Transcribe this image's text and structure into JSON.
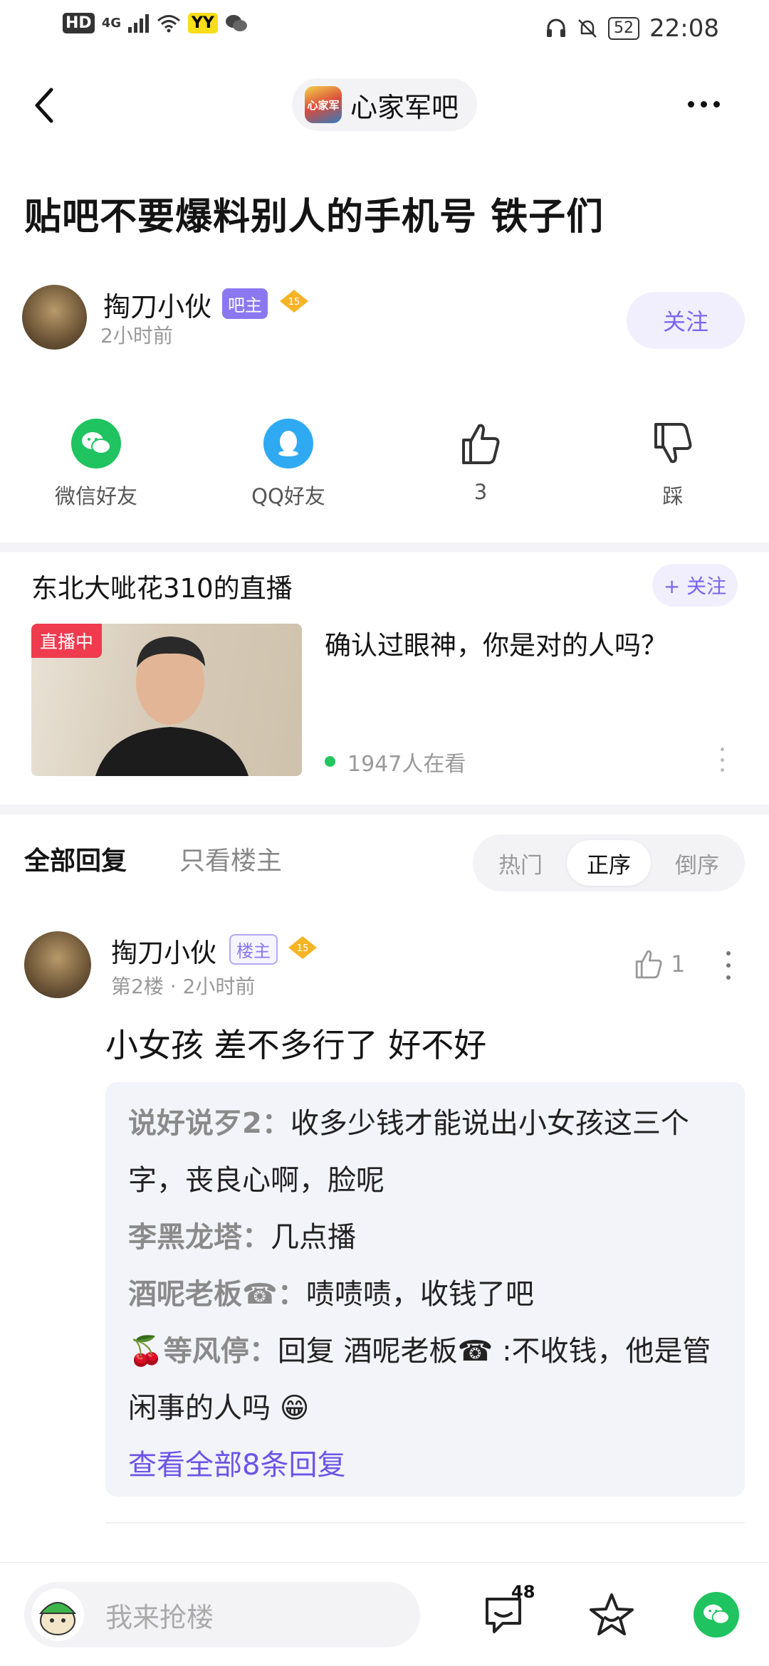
{
  "status_bar": {
    "hd": "HD",
    "network": "4G",
    "yy_badge": "YY",
    "battery": "52",
    "time": "22:08"
  },
  "header": {
    "forum_logo_text": "心家军",
    "forum_name": "心家军吧"
  },
  "post": {
    "title": "贴吧不要爆料别人的手机号 铁子们",
    "author": {
      "name": "掏刀小伙",
      "badge": "吧主",
      "level": "15",
      "time": "2小时前"
    },
    "follow_label": "关注"
  },
  "share": {
    "wechat": "微信好友",
    "qq": "QQ好友",
    "like_count": "3",
    "dislike": "踩"
  },
  "live": {
    "title": "东北大呲花310的直播",
    "follow_label": "+ 关注",
    "badge": "直播中",
    "description": "确认过眼神，你是对的人吗？",
    "viewers": "1947人在看"
  },
  "reply_tabs": {
    "all": "全部回复",
    "op_only": "只看楼主",
    "sort": [
      "热门",
      "正序",
      "倒序"
    ],
    "selected_sort": "正序"
  },
  "reply": {
    "name": "掏刀小伙",
    "badge": "楼主",
    "level": "15",
    "floor": "第2楼 · 2小时前",
    "like_count": "1",
    "content": "小女孩 差不多行了 好不好",
    "sub_replies": [
      {
        "author": "说好说歹2",
        "text": "收多少钱才能说出小女孩这三个字，丧良心啊，脸呢"
      },
      {
        "author": "李黑龙塔",
        "text": "几点播"
      },
      {
        "author": "酒呢老板☎",
        "text": "啧啧啧，收钱了吧"
      },
      {
        "author": "🍒等风停",
        "text": "回复 酒呢老板☎ :不收钱，他是管闲事的人吗 😁"
      }
    ],
    "view_all": "查看全部8条回复"
  },
  "bottom_bar": {
    "input_placeholder": "我来抢楼",
    "comment_count": "48"
  },
  "colors": {
    "accent": "#7c66ee",
    "link": "#6c54e6",
    "live_red": "#f03a4e",
    "wechat_green": "#1fc35f",
    "qq_blue": "#2fa9f2"
  }
}
